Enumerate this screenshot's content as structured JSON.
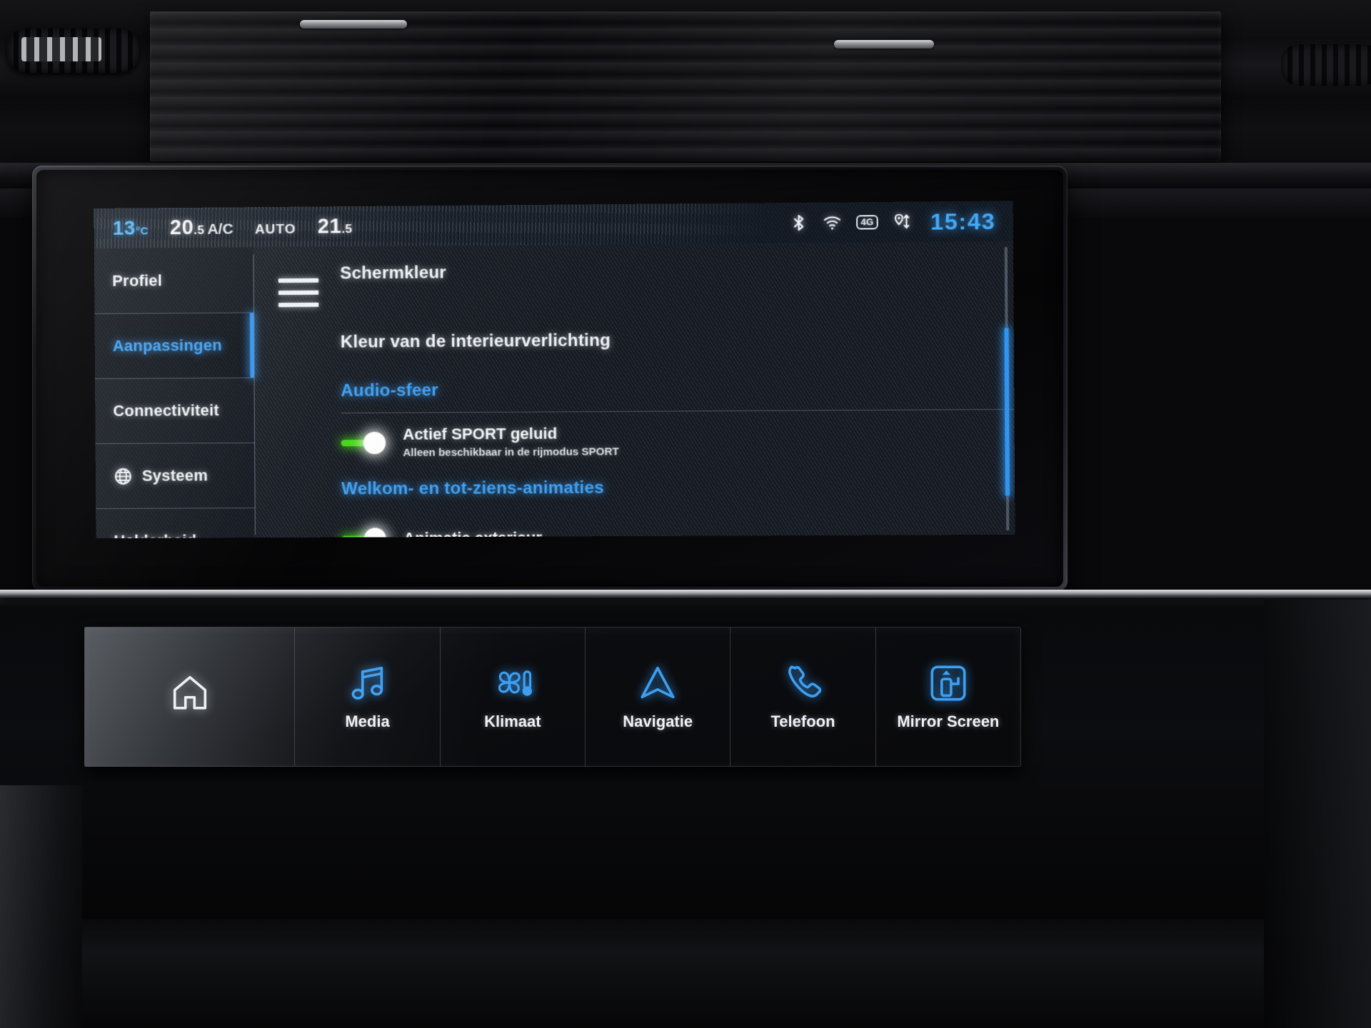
{
  "statusbar": {
    "exterior_temp": "13",
    "exterior_unit": "°C",
    "driver_temp_int": "20",
    "driver_temp_dec": ".5",
    "ac_label": "A/C",
    "auto_label": "AUTO",
    "passenger_temp_int": "21",
    "passenger_temp_dec": ".5",
    "clock": "15:43",
    "icons": [
      {
        "name": "bluetooth-icon",
        "label": "Bluetooth"
      },
      {
        "name": "wifi-icon",
        "label": "Wi-Fi"
      },
      {
        "name": "network-4g-icon",
        "label": "4G"
      },
      {
        "name": "location-data-icon",
        "label": "Location / data transfer"
      }
    ],
    "network_badge": "4G"
  },
  "sidebar": {
    "items": [
      {
        "label": "Profiel",
        "icon": null,
        "active": false
      },
      {
        "label": "Aanpassingen",
        "icon": null,
        "active": true
      },
      {
        "label": "Connectiviteit",
        "icon": null,
        "active": false
      },
      {
        "label": "Systeem",
        "icon": "globe-icon",
        "active": false
      },
      {
        "label": "Helderheid",
        "icon": null,
        "active": false
      }
    ]
  },
  "menu_button": {
    "name": "hamburger-menu",
    "label": "Menu"
  },
  "content": {
    "items": [
      {
        "type": "section",
        "label": "Schermkleur",
        "style": "white"
      },
      {
        "type": "section",
        "label": "Kleur van de interieurverlichting",
        "style": "white"
      },
      {
        "type": "section",
        "label": "Audio-sfeer",
        "style": "blue"
      },
      {
        "type": "toggle",
        "label": "Actief SPORT geluid",
        "sublabel": "Alleen beschikbaar in de rijmodus SPORT",
        "state": "on"
      },
      {
        "type": "section",
        "label": "Welkom- en tot-ziens-animaties",
        "style": "blue"
      },
      {
        "type": "toggle",
        "label": "Animatie exterieur",
        "sublabel": "",
        "state": "on"
      }
    ]
  },
  "bottom_bar": {
    "items": [
      {
        "label": "",
        "icon": "home-icon",
        "color": "white"
      },
      {
        "label": "Media",
        "icon": "music-note-icon",
        "color": "blue"
      },
      {
        "label": "Klimaat",
        "icon": "fan-thermometer-icon",
        "color": "blue"
      },
      {
        "label": "Navigatie",
        "icon": "navigation-arrow-icon",
        "color": "blue"
      },
      {
        "label": "Telefoon",
        "icon": "phone-handset-icon",
        "color": "blue"
      },
      {
        "label": "Mirror Screen",
        "icon": "screen-mirror-icon",
        "color": "blue"
      }
    ]
  },
  "colors": {
    "accent_blue": "#3d9ff2",
    "toggle_green": "#45d417",
    "text_white": "#eef2f7",
    "screen_bg": "#151a22"
  }
}
